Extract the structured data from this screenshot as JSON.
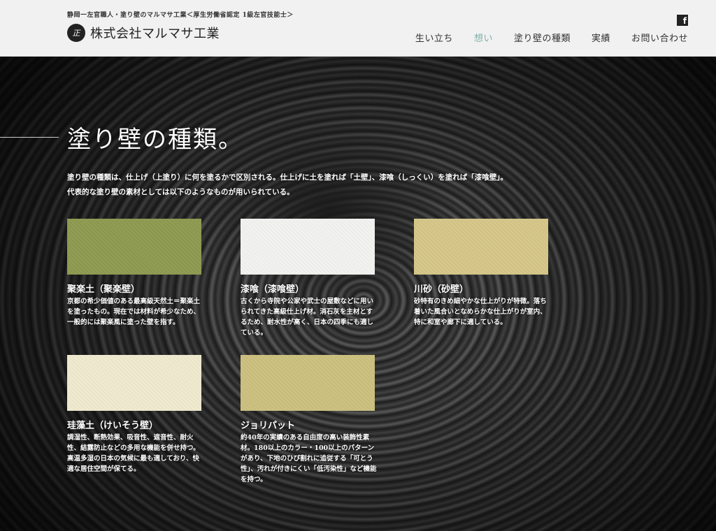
{
  "header": {
    "tagline": "静岡一左官職人・塗り壁のマルマサ工業＜厚生労働省認定 1級左官技能士＞",
    "logo_mark": "正",
    "company_name": "株式会社マルマサ工業",
    "facebook_icon_glyph": "f",
    "nav": [
      {
        "label": "生い立ち",
        "active": false
      },
      {
        "label": "想い",
        "active": true
      },
      {
        "label": "塗り壁の種類",
        "active": false
      },
      {
        "label": "実績",
        "active": false
      },
      {
        "label": "お問い合わせ",
        "active": false
      }
    ],
    "active_color": "#7fb0a8"
  },
  "main": {
    "title": "塗り壁の種類。",
    "intro_line1": "塗り壁の種類は、仕上げ（上塗り）に何を塗るかで区別される。仕上げに土を塗れば「土壁」、漆喰（しっくい）を塗れば「漆喰壁」。",
    "intro_line2": "代表的な塗り壁の素材としては以下のようなものが用いられている。"
  },
  "cards": [
    {
      "title": "聚楽土（聚楽壁）",
      "desc": "京都の希少価値のある最高級天然土＝聚楽土を塗ったもの。現在では材料が希少なため、一般的には聚楽風に塗った壁を指す。",
      "color": "#8e9a4f"
    },
    {
      "title": "漆喰（漆喰壁）",
      "desc": "古くから寺院や公家や武士の屋敷などに用いられてきた高級仕上げ材。消石灰を主材とするため、耐水性が高く、日本の四季にも適している。",
      "color": "#f4f4f2"
    },
    {
      "title": "川砂（砂壁）",
      "desc": "砂特有のきめ細やかな仕上がりが特徴。落ち着いた風合いとなめらかな仕上がりが室内、特に和室や廊下に適している。",
      "color": "#d7c787"
    },
    {
      "title": "珪藻土（けいそう壁）",
      "desc": "調湿性、断熱効果、吸音性、遮音性、耐火性、結露防止などの多用な機能を併せ持つ。高温多湿の日本の気候に最も適しており、快適な居住空間が保てる。",
      "color": "#f1ecd0"
    },
    {
      "title": "ジョリパット",
      "desc": "約40年の実績のある自由度の高い装飾性素材。180以上のカラー・100以上のパターンがあり、下地のひび割れに追従する「可とう性」、汚れが付きにくい「低汚染性」など機能を持つ。",
      "color": "#cdc17e"
    }
  ]
}
